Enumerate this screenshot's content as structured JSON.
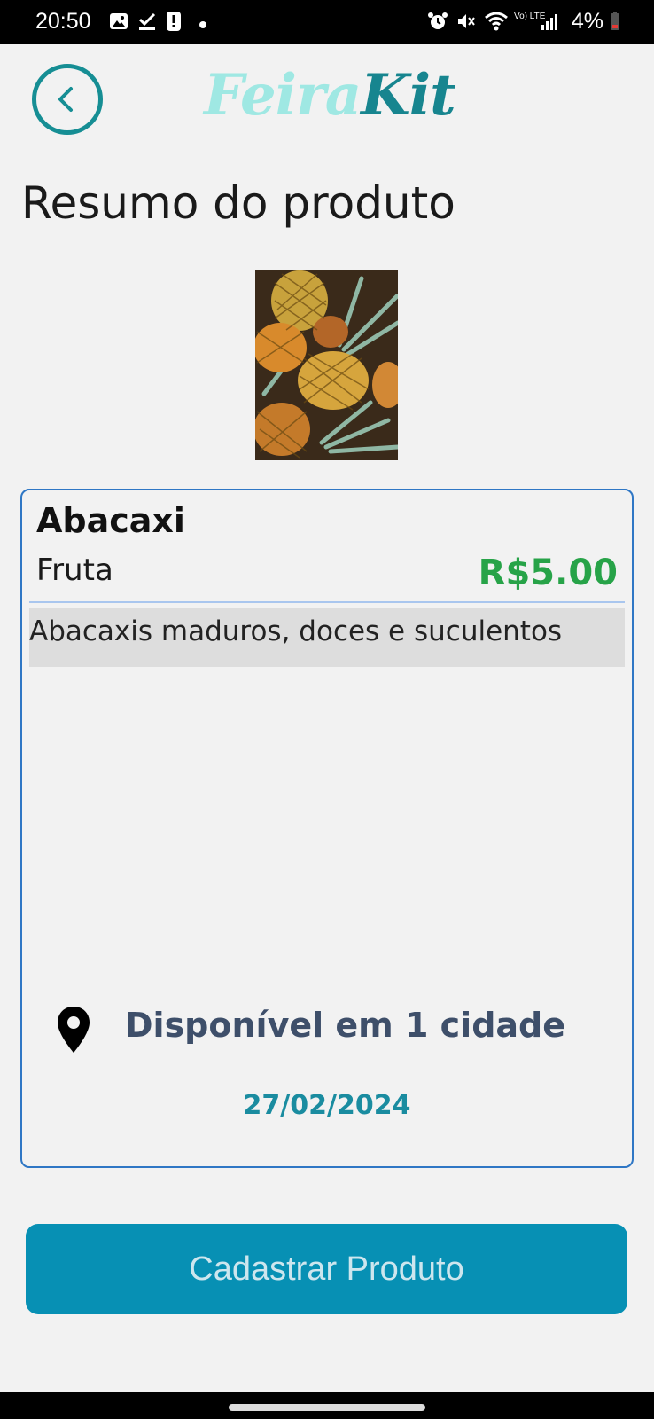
{
  "status_bar": {
    "time": "20:50",
    "battery_percent": "4%",
    "network_label": "Vo) LTE"
  },
  "header": {
    "logo_part1": "Feira",
    "logo_part2": "Kit"
  },
  "page": {
    "title": "Resumo do produto"
  },
  "product": {
    "name": "Abacaxi",
    "category": "Fruta",
    "price": "R$5.00",
    "description": "Abacaxis maduros, doces e suculentos",
    "availability": "Disponível em 1 cidade",
    "date": "27/02/2024"
  },
  "actions": {
    "primary_label": "Cadastrar Produto"
  },
  "colors": {
    "accent": "#168e94",
    "button": "#0790b4",
    "price": "#27a348",
    "card_border": "#2f77c5"
  }
}
